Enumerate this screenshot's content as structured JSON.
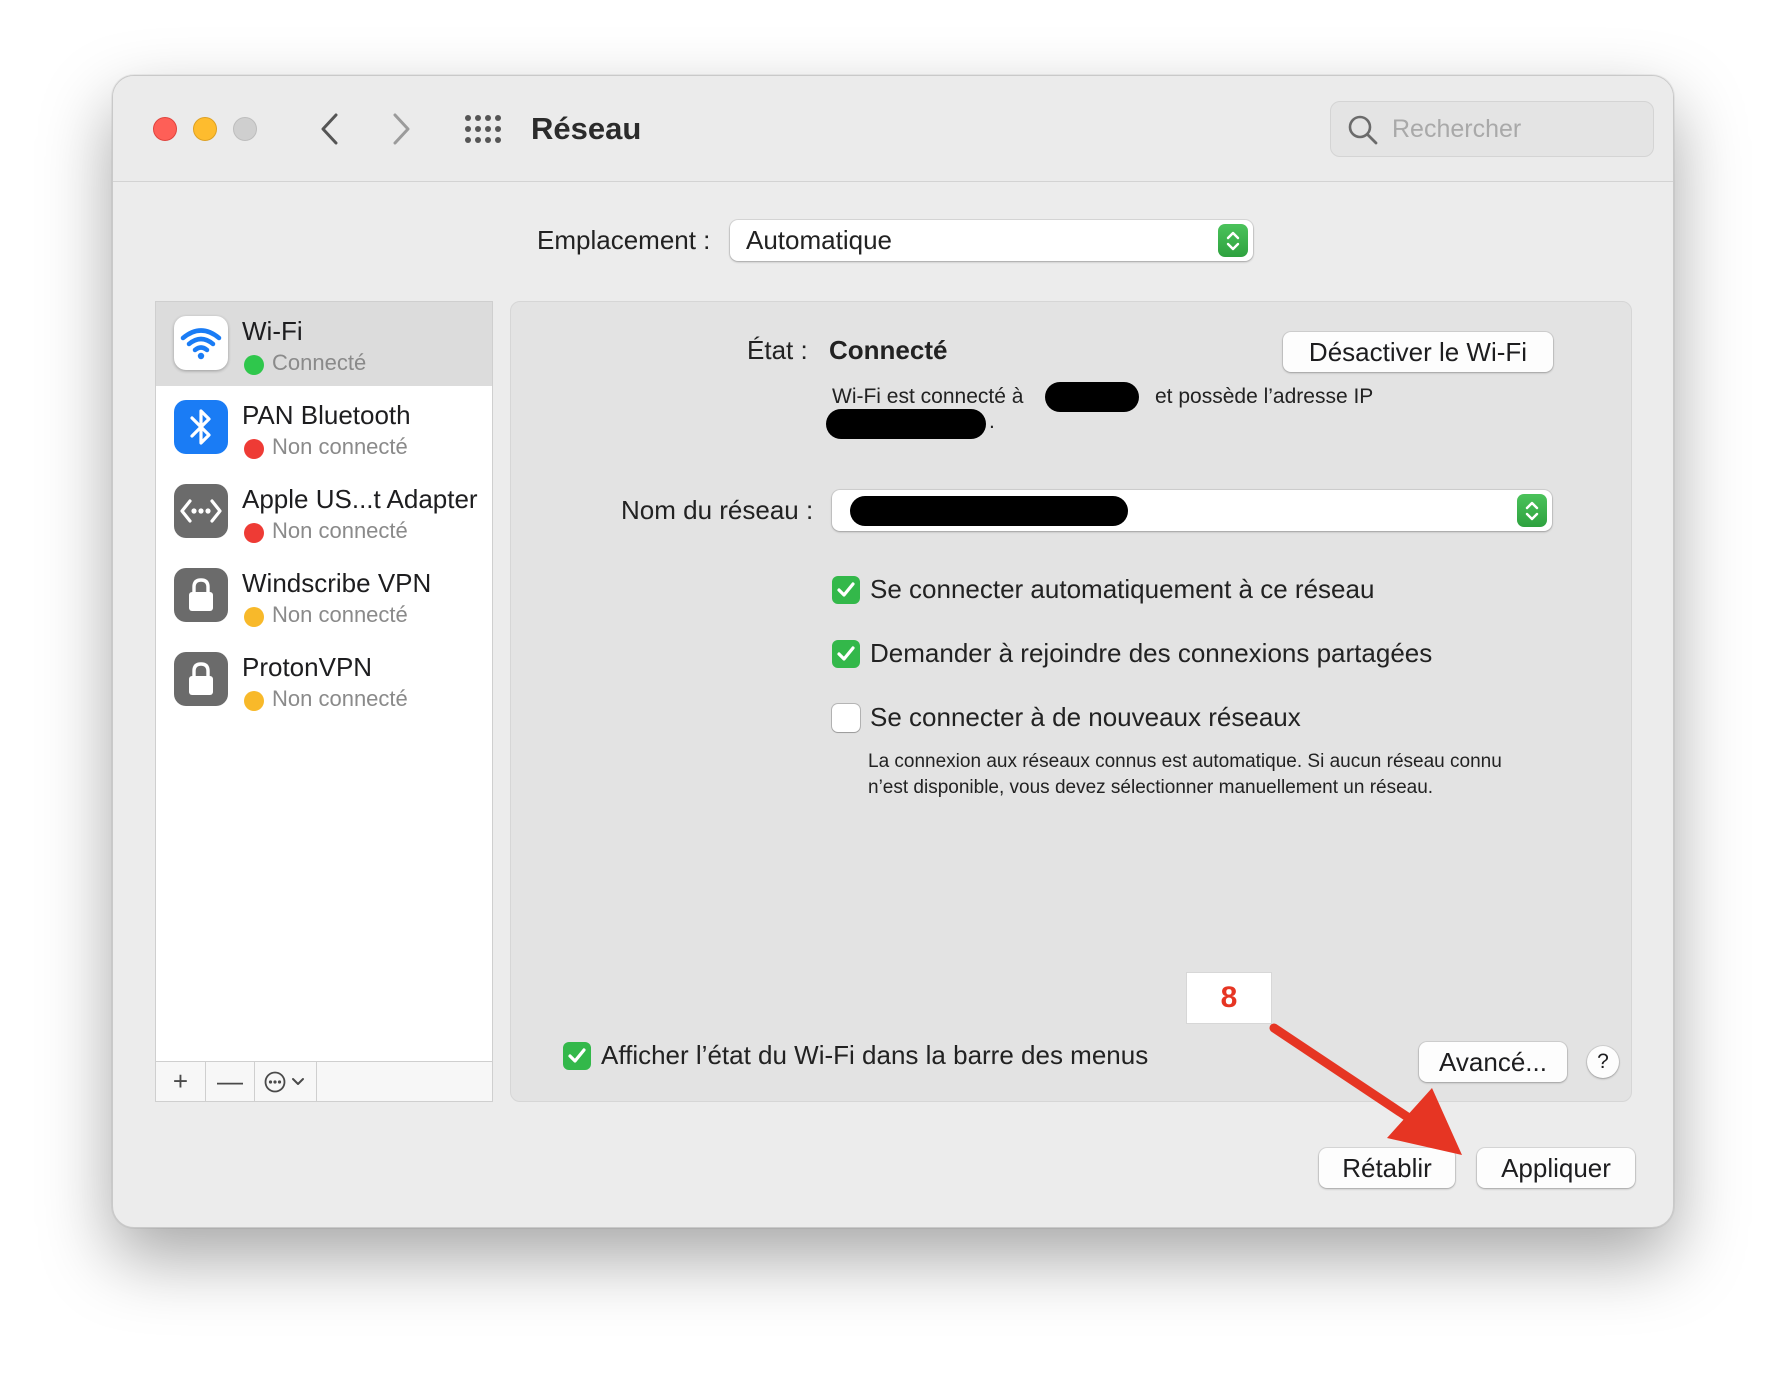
{
  "window": {
    "title": "Réseau"
  },
  "search": {
    "placeholder": "Rechercher"
  },
  "location": {
    "label": "Emplacement :",
    "value": "Automatique"
  },
  "sidebar": {
    "services": [
      {
        "name": "Wi-Fi",
        "status": "Connecté",
        "icon": "wifi-icon",
        "status_color": "#2fc74c"
      },
      {
        "name": "PAN Bluetooth",
        "status": "Non connecté",
        "icon": "bluetooth-icon",
        "status_color": "#ee3b35"
      },
      {
        "name": "Apple US...t Adapter",
        "status": "Non connecté",
        "icon": "ethernet-icon",
        "status_color": "#ee3b35"
      },
      {
        "name": "Windscribe VPN",
        "status": "Non connecté",
        "icon": "lock-icon",
        "status_color": "#f8b92a"
      },
      {
        "name": "ProtonVPN",
        "status": "Non connecté",
        "icon": "lock-icon",
        "status_color": "#f8b92a"
      }
    ],
    "toolbar": {
      "add": "+",
      "remove": "—"
    }
  },
  "panel": {
    "state_label": "État :",
    "state_value": "Connecté",
    "toggle_button": "Désactiver le Wi-Fi",
    "info_prefix": "Wi-Fi est connecté à",
    "info_middle": "et possède l’adresse IP",
    "info_end": ".",
    "network_label": "Nom du réseau :",
    "checkboxes": [
      {
        "label": "Se connecter automatiquement à ce réseau",
        "checked": true
      },
      {
        "label": "Demander à rejoindre des connexions partagées",
        "checked": true
      },
      {
        "label": "Se connecter à de nouveaux réseaux",
        "checked": false
      }
    ],
    "help_text": "La connexion aux réseaux connus est automatique. Si aucun réseau connu n’est disponible, vous devez sélectionner manuellement un réseau.",
    "menu_bar_checkbox": {
      "label": "Afficher l’état du Wi-Fi dans la barre des menus",
      "checked": true
    },
    "advanced_button": "Avancé...",
    "help_button": "?"
  },
  "footer": {
    "reset_button": "Rétablir",
    "apply_button": "Appliquer"
  },
  "annotation": {
    "step": "8",
    "color": "#e63523"
  }
}
